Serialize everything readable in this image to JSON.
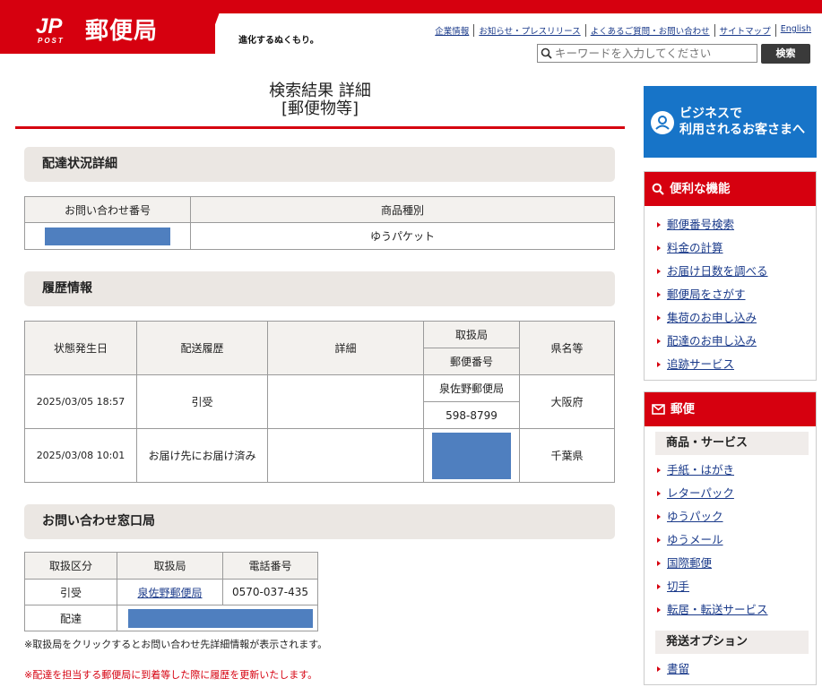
{
  "header": {
    "logo_text": "郵便局",
    "logo_mark_text": "JP",
    "logo_mark_sub": "POST",
    "tagline": "進化するぬくもり。",
    "top_links": [
      "企業情報",
      "お知らせ・プレスリリース",
      "よくあるご質問・お問い合わせ",
      "サイトマップ",
      "English"
    ],
    "search_placeholder": "キーワードを入力してください",
    "search_button": "検索"
  },
  "main": {
    "title_line1": "検索結果 詳細",
    "title_line2": "[郵便物等]",
    "delivery_status": {
      "heading": "配達状況詳細",
      "col_tracking": "お問い合わせ番号",
      "col_type": "商品種別",
      "product_type": "ゆうパケット"
    },
    "history": {
      "heading": "履歴情報",
      "col_date": "状態発生日",
      "col_history": "配送履歴",
      "col_detail": "詳細",
      "col_office": "取扱局",
      "col_postcode": "郵便番号",
      "col_pref": "県名等",
      "rows": [
        {
          "date": "2025/03/05 18:57",
          "status": "引受",
          "detail": "",
          "office": "泉佐野郵便局",
          "postcode": "598-8799",
          "pref": "大阪府"
        },
        {
          "date": "2025/03/08 10:01",
          "status": "お届け先にお届け済み",
          "detail": "",
          "office": "",
          "postcode": "",
          "pref": "千葉県"
        }
      ]
    },
    "contact": {
      "heading": "お問い合わせ窓口局",
      "col_type": "取扱区分",
      "col_office": "取扱局",
      "col_phone": "電話番号",
      "rows": [
        {
          "type": "引受",
          "office": "泉佐野郵便局",
          "phone": "0570-037-435"
        },
        {
          "type": "配達",
          "office": "",
          "phone": ""
        }
      ],
      "note": "※取扱局をクリックするとお問い合わせ先詳細情報が表示されます。",
      "note_red": "※配達を担当する郵便局に到着等した際に履歴を更新いたします。"
    }
  },
  "side": {
    "business_banner": {
      "line1": "ビジネスで",
      "line2": "利用されるお客さまへ"
    },
    "useful": {
      "heading": "便利な機能",
      "items": [
        "郵便番号検索",
        "料金の計算",
        "お届け日数を調べる",
        "郵便局をさがす",
        "集荷のお申し込み",
        "配達のお申し込み",
        "追跡サービス"
      ]
    },
    "mail": {
      "heading": "郵便",
      "sub1": "商品・サービス",
      "items": [
        "手紙・はがき",
        "レターパック",
        "ゆうパック",
        "ゆうメール",
        "国際郵便",
        "切手",
        "転居・転送サービス"
      ],
      "sub2": "発送オプション",
      "items2": [
        "書留"
      ]
    }
  },
  "colors": {
    "brand_red": "#d6000f",
    "business_blue": "#1774c8",
    "redaction_blue": "#4f7fbf"
  }
}
